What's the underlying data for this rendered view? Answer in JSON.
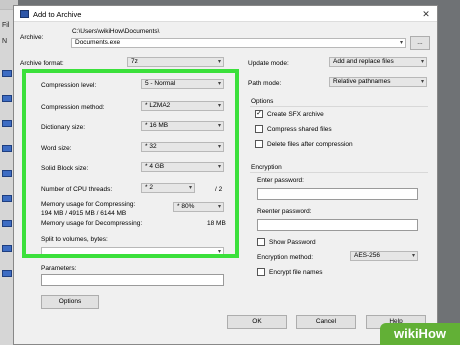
{
  "window": {
    "title": "Add to Archive"
  },
  "background": {
    "letters": [
      "Fil",
      "N"
    ]
  },
  "archive": {
    "label": "Archive:",
    "path": "C:\\Users\\wikiHow\\Documents\\",
    "name": "Documents.exe",
    "browse_label": "..."
  },
  "left": {
    "archive_format": {
      "label": "Archive format:",
      "value": "7z"
    },
    "compression_level": {
      "label": "Compression level:",
      "value": "5 - Normal"
    },
    "compression_method": {
      "label": "Compression method:",
      "value": "* LZMA2"
    },
    "dictionary_size": {
      "label": "Dictionary size:",
      "value": "* 16 MB"
    },
    "word_size": {
      "label": "Word size:",
      "value": "* 32"
    },
    "solid_block_size": {
      "label": "Solid Block size:",
      "value": "* 4 GB"
    },
    "cpu_threads": {
      "label": "Number of CPU threads:",
      "value": "* 2",
      "total": "/ 2"
    },
    "memory_compress": {
      "label": "Memory usage for Compressing:",
      "detail": "194 MB / 4915 MB / 6144 MB",
      "value": "* 80%"
    },
    "memory_decompress": {
      "label": "Memory usage for Decompressing:",
      "value": "18 MB"
    },
    "split_volumes": {
      "label": "Split to volumes, bytes:",
      "value": ""
    },
    "parameters": {
      "label": "Parameters:",
      "value": ""
    },
    "options_button": "Options"
  },
  "right": {
    "update_mode": {
      "label": "Update mode:",
      "value": "Add and replace files"
    },
    "path_mode": {
      "label": "Path mode:",
      "value": "Relative pathnames"
    },
    "options_group": "Options",
    "create_sfx": {
      "label": "Create SFX archive",
      "checked": true
    },
    "compress_shared": {
      "label": "Compress shared files",
      "checked": false
    },
    "delete_after": {
      "label": "Delete files after compression",
      "checked": false
    },
    "encryption_group": "Encryption",
    "enter_password": {
      "label": "Enter password:",
      "value": ""
    },
    "reenter_password": {
      "label": "Reenter password:",
      "value": ""
    },
    "show_password": {
      "label": "Show Password",
      "checked": false
    },
    "encryption_method": {
      "label": "Encryption method:",
      "value": "AES-256"
    },
    "encrypt_names": {
      "label": "Encrypt file names",
      "checked": false
    }
  },
  "buttons": {
    "ok": "OK",
    "cancel": "Cancel",
    "help": "Help"
  },
  "watermark": "wikiHow",
  "colors": {
    "highlight": "#3be03b",
    "watermark": "#62b036"
  }
}
